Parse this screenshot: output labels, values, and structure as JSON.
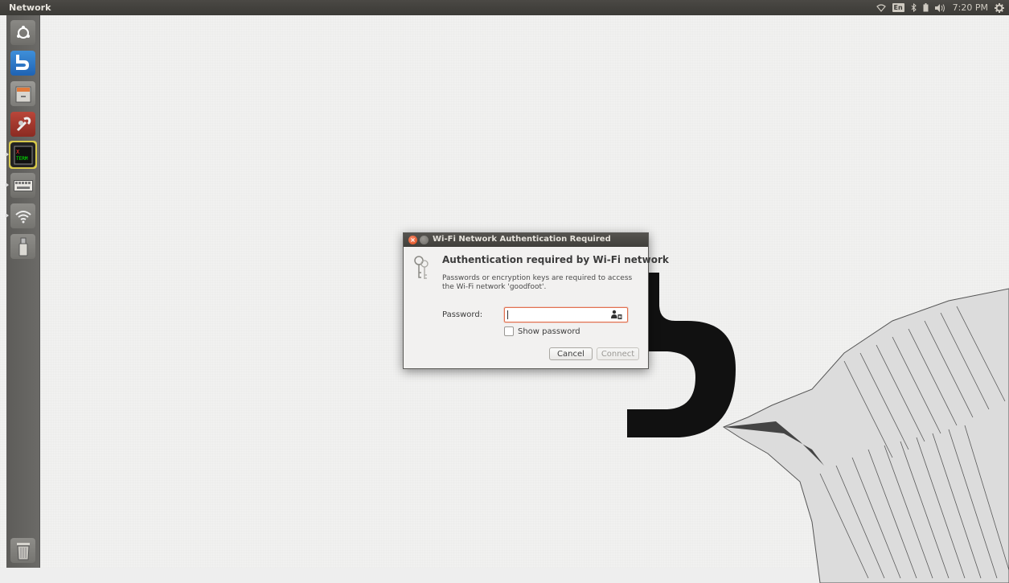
{
  "topbar": {
    "app_title": "Network",
    "keyboard_layout": "En",
    "clock": "7:20 PM",
    "icons": [
      "wifi-icon",
      "keyboard-layout-icon",
      "bluetooth-icon",
      "battery-icon",
      "volume-icon",
      "gear-icon"
    ]
  },
  "launcher": {
    "items": [
      {
        "name": "ubuntu-dash",
        "icon": "ubuntu-logo-icon"
      },
      {
        "name": "app-hook",
        "icon": "hook-icon"
      },
      {
        "name": "file-manager",
        "icon": "file-cabinet-icon"
      },
      {
        "name": "system-tools",
        "icon": "wrench-icon"
      },
      {
        "name": "xterm",
        "icon": "xterm-icon",
        "label": "X TERM"
      },
      {
        "name": "keyboard",
        "icon": "keyboard-icon"
      },
      {
        "name": "network",
        "icon": "wifi-icon"
      },
      {
        "name": "usb",
        "icon": "usb-drive-icon"
      },
      {
        "name": "trash",
        "icon": "trash-icon"
      }
    ]
  },
  "dialog": {
    "title": "Wi-Fi Network Authentication Required",
    "heading": "Authentication required by Wi-Fi network",
    "description": "Passwords or encryption keys are required to access the Wi-Fi network 'goodfoot'.",
    "password_label": "Password:",
    "password_value": "",
    "show_password_label": "Show password",
    "show_password_checked": false,
    "cancel_label": "Cancel",
    "connect_label": "Connect",
    "connect_enabled": false
  },
  "colors": {
    "panel": "#3b3a36",
    "launcher": "#63625f",
    "close_button": "#df4a16",
    "input_focus": "#e2714f"
  }
}
